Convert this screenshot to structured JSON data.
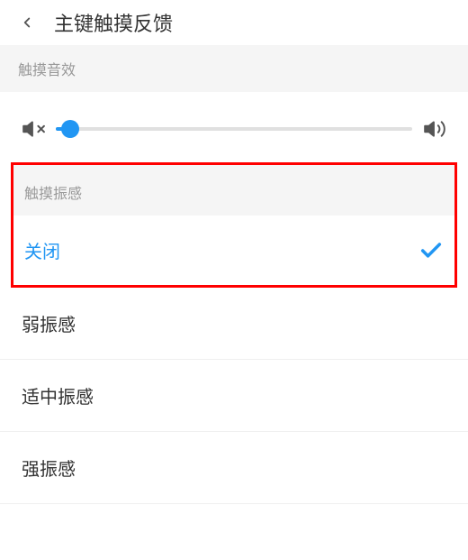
{
  "header": {
    "title": "主键触摸反馈"
  },
  "sections": {
    "sound": {
      "label": "触摸音效"
    },
    "vibration": {
      "label": "触摸振感"
    }
  },
  "options": {
    "off": "关闭",
    "weak": "弱振感",
    "medium": "适中振感",
    "strong": "强振感"
  },
  "colors": {
    "accent": "#2196f3",
    "highlight": "#ff0000"
  }
}
